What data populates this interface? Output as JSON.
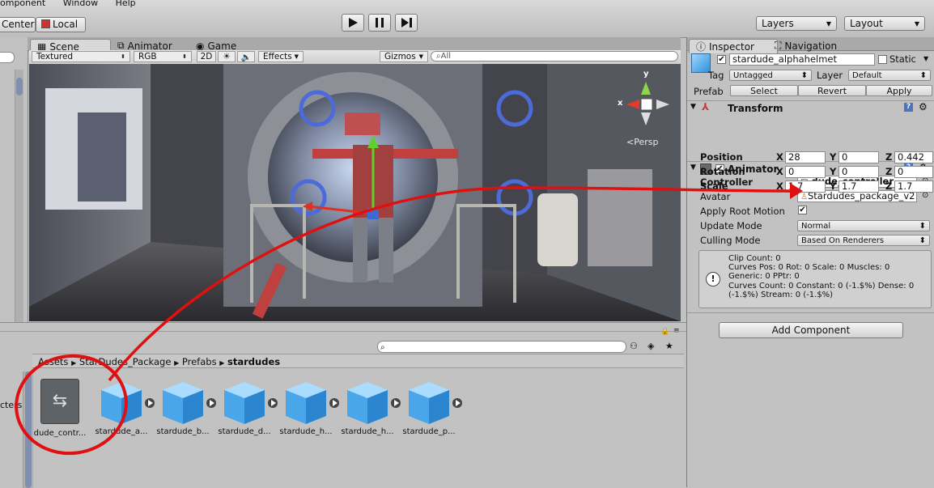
{
  "menu": [
    "omponent",
    "Window",
    "Help"
  ],
  "toolbar": {
    "center_label": "Center",
    "local_label": "Local",
    "layers_label": "Layers",
    "layout_label": "Layout"
  },
  "tabs": {
    "scene": "Scene",
    "animator": "Animator",
    "game": "Game",
    "inspector": "Inspector",
    "navigation": "Navigation"
  },
  "scene_toolbar": {
    "shading": "Textured",
    "render_mode": "RGB",
    "mode_2d": "2D",
    "effects": "Effects",
    "gizmos": "Gizmos",
    "search_placeholder": "All",
    "persp_label": "Persp",
    "axis_x": "x",
    "axis_y": "y"
  },
  "inspector": {
    "object_name": "stardude_alphahelmet",
    "static_label": "Static",
    "tag_label": "Tag",
    "tag_value": "Untagged",
    "layer_label": "Layer",
    "layer_value": "Default",
    "prefab_label": "Prefab",
    "select_label": "Select",
    "revert_label": "Revert",
    "apply_label": "Apply",
    "transform": {
      "title": "Transform",
      "position_label": "Position",
      "rotation_label": "Rotation",
      "scale_label": "Scale",
      "x": "X",
      "y": "Y",
      "z": "Z",
      "position": [
        "28",
        "0",
        "0.442"
      ],
      "rotation": [
        "0",
        "0",
        "0"
      ],
      "scale": [
        "1.7",
        "1.7",
        "1.7"
      ]
    },
    "animator": {
      "title": "Animator",
      "controller_label": "Controller",
      "controller_value": "dude_controller",
      "avatar_label": "Avatar",
      "avatar_value": "Stardudes_package_v2",
      "apply_root_label": "Apply Root Motion",
      "update_mode_label": "Update Mode",
      "update_mode_value": "Normal",
      "culling_label": "Culling Mode",
      "culling_value": "Based On Renderers",
      "info_lines": [
        "Clip Count: 0",
        "Curves Pos: 0 Rot: 0 Scale: 0 Muscles: 0",
        "Generic: 0 PPtr: 0",
        "Curves Count: 0 Constant: 0 (-1.$%) Dense: 0",
        "(-1.$%) Stream: 0 (-1.$%)"
      ]
    },
    "add_component_label": "Add Component"
  },
  "project": {
    "breadcrumb": [
      "Assets",
      "StarDudes_Package",
      "Prefabs",
      "stardudes"
    ],
    "side_text": "cters",
    "assets": [
      {
        "label": "dude_contr...",
        "kind": "controller"
      },
      {
        "label": "stardude_a...",
        "kind": "prefab"
      },
      {
        "label": "stardude_b...",
        "kind": "prefab"
      },
      {
        "label": "stardude_d...",
        "kind": "prefab"
      },
      {
        "label": "stardude_h...",
        "kind": "prefab"
      },
      {
        "label": "stardude_h...",
        "kind": "prefab"
      },
      {
        "label": "stardude_p...",
        "kind": "prefab"
      }
    ]
  },
  "colors": {
    "annotation_red": "#e01010",
    "prefab_blue": "#3aa6e6",
    "panel_gray": "#c2c2c2"
  }
}
